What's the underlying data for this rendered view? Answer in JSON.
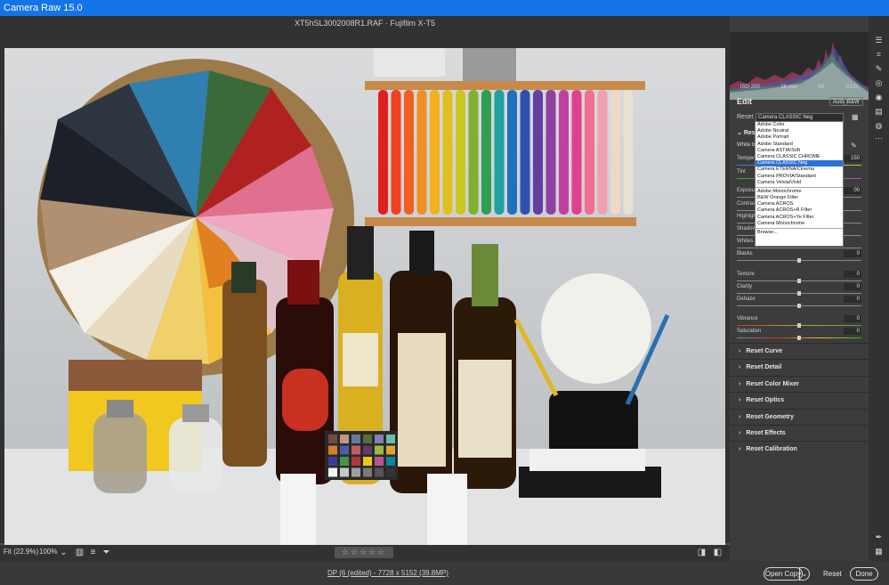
{
  "app": {
    "title": "Camera Raw 15.0"
  },
  "file": {
    "name": "XT5hSL3002008R1.RAF  ·  Fujifilm X-T5"
  },
  "histogram": {
    "iso": "ISO 200",
    "focal": "36 mm",
    "aperture": "f/8",
    "shutter": "1/13s"
  },
  "edit": {
    "title": "Edit",
    "auto_label": "Auto",
    "bw_label": "B&W",
    "profile_label": "Reset",
    "profile_value": "Camera CLASSIC Neg",
    "basic_label": "Rese",
    "white_balance_label": "White ba",
    "temp_label": "Temper",
    "temp_value": "150",
    "tint_label": "Tint",
    "exposure_label": "Exposur",
    "exposure_value": "00",
    "contrast_label": "Contras",
    "highlights_label": "Highlight",
    "shadows_label": "Shadow",
    "whites_label": "Whites",
    "blacks_label": "Blacks",
    "blacks_value": "0",
    "texture_label": "Texture",
    "texture_value": "0",
    "clarity_label": "Clarity",
    "clarity_value": "0",
    "dehaze_label": "Dehaze",
    "dehaze_value": "0",
    "vibrance_label": "Vibrance",
    "vibrance_value": "0",
    "saturation_label": "Saturation",
    "saturation_value": "0"
  },
  "profiles": {
    "color": [
      "Adobe Color",
      "Adobe Neutral",
      "Adobe Portrait",
      "Adobe Standard",
      "Camera ASTIA/Soft",
      "Camera CLASSIC CHROME",
      "Camera CLASSIC Neg",
      "Camera ETERNA/Cinema",
      "Camera PROVIA/Standard",
      "Camera Velvia/Vivid"
    ],
    "selected_index": 6,
    "mono": [
      "Adobe Monochrome",
      "B&W Orange Filter",
      "Camera ACROS",
      "Camera ACROS+R Filter",
      "Camera ACROS+Ye Filter",
      "Camera Monochrome"
    ],
    "browse": "Browse..."
  },
  "sections": [
    "Reset Curve",
    "Reset Detail",
    "Reset Color Mixer",
    "Reset Optics",
    "Reset Geometry",
    "Reset Effects",
    "Reset Calibration"
  ],
  "toolbar": {
    "fit_label": "Fit (22.9%)",
    "zoom_label": "100%",
    "stars": "☆☆☆☆☆"
  },
  "footer": {
    "info": "DP (6 (edited) - 7728 x 5152 (39.8MP)",
    "open_copy": "Open Copy",
    "reset": "Reset",
    "done": "Done"
  },
  "icons": {
    "save": "save-icon",
    "gear": "gear-icon",
    "expand": "expand-icon"
  }
}
